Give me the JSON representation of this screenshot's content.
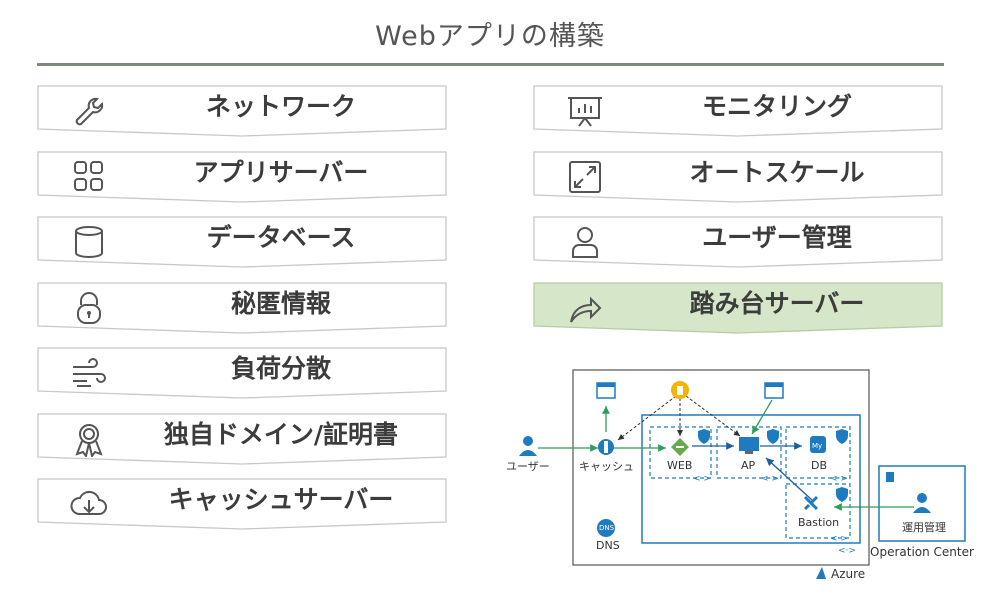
{
  "title": "Webアプリの構築",
  "left_items": [
    {
      "label": "ネットワーク",
      "icon": "wrench-icon"
    },
    {
      "label": "アプリサーバー",
      "icon": "app-grid-icon"
    },
    {
      "label": "データベース",
      "icon": "database-icon"
    },
    {
      "label": "秘匿情報",
      "icon": "lock-icon"
    },
    {
      "label": "負荷分散",
      "icon": "wind-icon"
    },
    {
      "label": "独自ドメイン/証明書",
      "icon": "award-ribbon-icon"
    },
    {
      "label": "キャッシュサーバー",
      "icon": "cloud-download-icon"
    }
  ],
  "right_items": [
    {
      "label": "モニタリング",
      "icon": "presentation-chart-icon"
    },
    {
      "label": "オートスケール",
      "icon": "expand-arrows-icon"
    },
    {
      "label": "ユーザー管理",
      "icon": "person-icon"
    },
    {
      "label": "踏み台サーバー",
      "icon": "share-arrow-icon",
      "highlight": true
    }
  ],
  "colors": {
    "item_fill": "#ffffff",
    "item_border": "#c8c8c8",
    "highlight_fill": "#d6e6c8",
    "rule": "#7b8a7b",
    "azure_blue": "#1e7bbf",
    "arrow_green": "#2e9e5b"
  },
  "diagram": {
    "user_label": "ユーザー",
    "cache_label": "キャッシュ",
    "web_label": "WEB",
    "ap_label": "AP",
    "db_label": "DB",
    "bastion_label": "Bastion",
    "dns_badge": "DNS",
    "dns_label": "DNS",
    "azure_label": "Azure",
    "ops_label": "運用管理",
    "ops_center_label": "Operation Center"
  }
}
